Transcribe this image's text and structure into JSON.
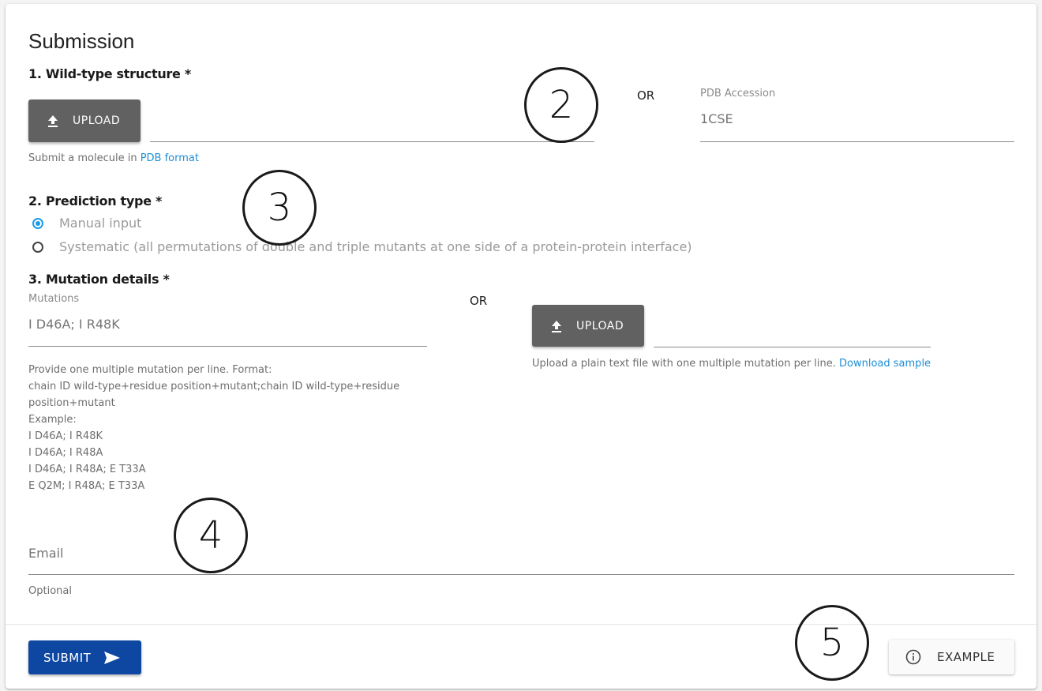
{
  "title": "Submission",
  "section1": {
    "heading": "1. Wild-type structure *",
    "upload_label": "UPLOAD",
    "hint_prefix": "Submit a molecule in ",
    "hint_link": "PDB format",
    "or_label": "OR",
    "pdb_field": {
      "label": "PDB Accession",
      "placeholder": "1CSE",
      "value": ""
    }
  },
  "section2": {
    "heading": "2. Prediction type *",
    "options": [
      {
        "label": "Manual input",
        "selected": true
      },
      {
        "label": "Systematic (all permutations of double and triple mutants at one side of a protein-protein interface)",
        "selected": false
      }
    ]
  },
  "section3": {
    "heading": "3. Mutation details *",
    "mutations_field": {
      "label": "Mutations",
      "placeholder": "I D46A; I R48K",
      "value": ""
    },
    "helper_lines": [
      "Provide one multiple mutation per line. Format:",
      "chain ID wild-type+residue position+mutant;chain ID wild-type+residue",
      "position+mutant",
      "Example:",
      "I D46A; I R48K",
      "I D46A; I R48A",
      "I D46A; I R48A; E T33A",
      "E Q2M; I R48A; E T33A"
    ],
    "or_label": "OR",
    "upload_label": "UPLOAD",
    "upload_hint": "Upload a plain text file with one multiple mutation per line. ",
    "upload_link": "Download sample"
  },
  "email": {
    "placeholder": "Email",
    "helper": "Optional",
    "value": ""
  },
  "footer": {
    "submit_label": "SUBMIT",
    "example_label": "EXAMPLE"
  },
  "annotations": [
    "2",
    "3",
    "4",
    "5"
  ],
  "colors": {
    "primary": "#0d47a1",
    "link": "#1e8fd6",
    "radio": "#1a9be8",
    "upload_button": "#616161"
  }
}
